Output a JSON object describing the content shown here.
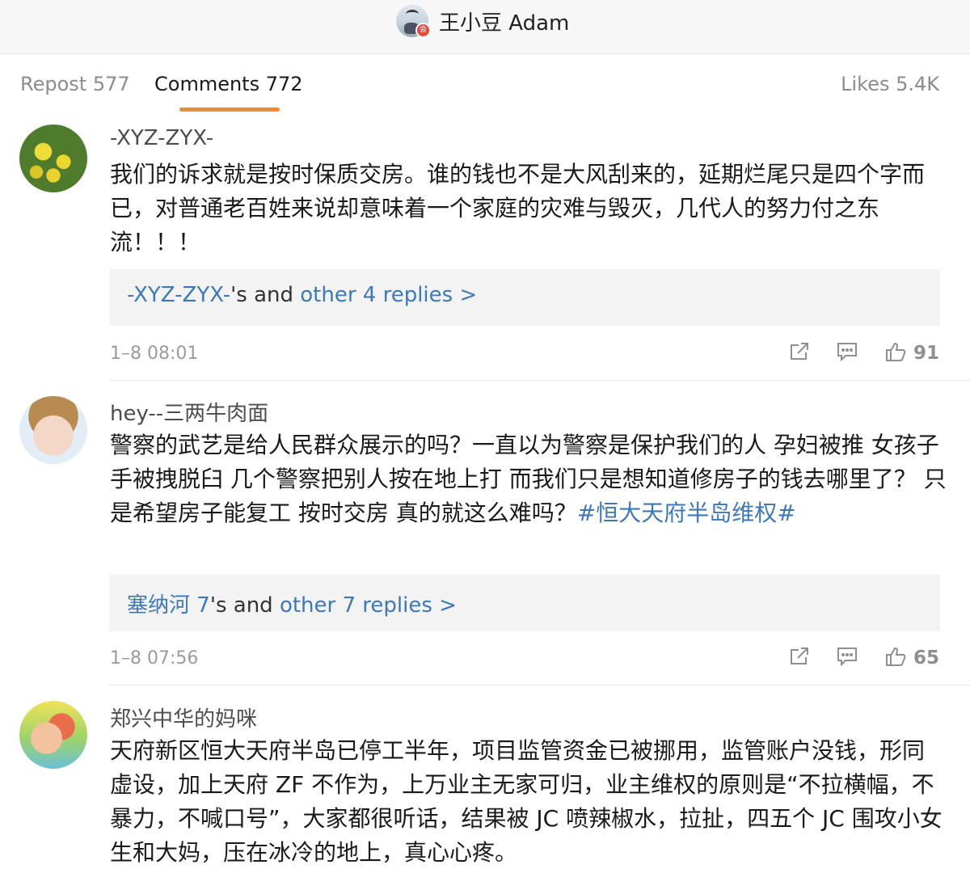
{
  "header": {
    "author_name": "王小豆 Adam",
    "verify_badge": "会"
  },
  "tabs": {
    "repost": "Repost 577",
    "comments": "Comments 772",
    "likes": "Likes 5.4K",
    "active_color": "#f28a30"
  },
  "comments": [
    {
      "username": "-XYZ-ZYX-",
      "text": "我们的诉求就是按时保质交房。谁的钱也不是大风刮来的，延期烂尾只是四个字而已，对普通老百姓来说却意味着一个家庭的灾难与毁灭，几代人的努力付之东流！！！",
      "replies_user": "-XYZ-ZYX-",
      "replies_mid": "'s and ",
      "replies_link": "other 4 replies >",
      "timestamp": "1–8 08:01",
      "likes": "91"
    },
    {
      "username": "hey--三两牛肉面",
      "text": "警察的武艺是给人民群众展示的吗？一直以为警察是保护我们的人 孕妇被推 女孩子手被拽脱臼 几个警察把别人按在地上打 而我们只是想知道修房子的钱去哪里了？ 只是希望房子能复工 按时交房 真的就这么难吗？",
      "hashtag": "#恒大天府半岛维权#",
      "replies_user": "塞纳河 7",
      "replies_mid": "'s and ",
      "replies_link": "other 7 replies >",
      "timestamp": "1–8 07:56",
      "likes": "65"
    },
    {
      "username": "郑兴中华的妈咪",
      "text": "天府新区恒大天府半岛已停工半年，项目监管资金已被挪用，监管账户没钱，形同虚设，加上天府 ZF 不作为，上万业主无家可归，业主维权的原则是“不拉横幅，不暴力，不喊口号”，大家都很听话，结果被 JC 喷辣椒水，拉扯，四五个 JC 围攻小女生和大妈，压在冰冷的地上，真心心疼。"
    }
  ],
  "colors": {
    "link": "#3d79b6",
    "muted": "#9b9b9b"
  }
}
